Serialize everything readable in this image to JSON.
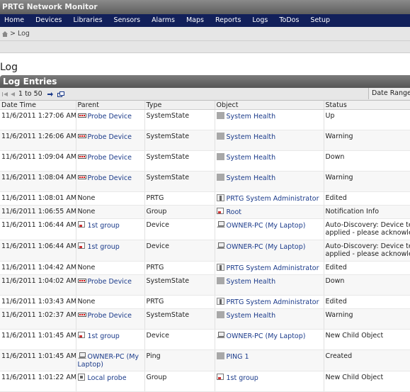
{
  "app": {
    "title": "PRTG Network Monitor"
  },
  "nav": [
    "Home",
    "Devices",
    "Libraries",
    "Sensors",
    "Alarms",
    "Maps",
    "Reports",
    "Logs",
    "ToDos",
    "Setup"
  ],
  "breadcrumb": {
    "separator": ">",
    "current": "Log"
  },
  "page_title": "Log",
  "panel": {
    "title": "Log Entries",
    "pager_range": "1 to 50",
    "date_range_label": "Date Range:"
  },
  "columns": [
    "Date Time",
    "Parent",
    "Type",
    "Object",
    "Status"
  ],
  "rows": [
    {
      "dt": "11/6/2011 1:27:06 AM",
      "parent": "Probe Device",
      "parent_icon": "device-icon",
      "type": "SystemState",
      "object": "System Health",
      "object_icon": "sensor-icon",
      "status": "Up",
      "status2": ""
    },
    {
      "dt": "11/6/2011 1:26:06 AM",
      "parent": "Probe Device",
      "parent_icon": "device-icon",
      "type": "SystemState",
      "object": "System Health",
      "object_icon": "sensor-icon",
      "status": "Warning",
      "status2": ""
    },
    {
      "dt": "11/6/2011 1:09:04 AM",
      "parent": "Probe Device",
      "parent_icon": "device-icon",
      "type": "SystemState",
      "object": "System Health",
      "object_icon": "sensor-icon",
      "status": "Down",
      "status2": ""
    },
    {
      "dt": "11/6/2011 1:08:04 AM",
      "parent": "Probe Device",
      "parent_icon": "device-icon",
      "type": "SystemState",
      "object": "System Health",
      "object_icon": "sensor-icon",
      "status": "Warning",
      "status2": ""
    },
    {
      "dt": "11/6/2011 1:08:01 AM",
      "parent": "None",
      "parent_icon": "",
      "type": "PRTG",
      "object": "PRTG System Administrator",
      "object_icon": "user-icon",
      "status": "Edited",
      "status2": ""
    },
    {
      "dt": "11/6/2011 1:06:55 AM",
      "parent": "None",
      "parent_icon": "",
      "type": "Group",
      "object": "Root",
      "object_icon": "group-icon",
      "status": "Notification Info",
      "status2": ""
    },
    {
      "dt": "11/6/2011 1:06:44 AM",
      "parent": "1st group",
      "parent_icon": "group-icon",
      "type": "Device",
      "object": "OWNER-PC (My Laptop)",
      "object_icon": "laptop-icon",
      "status": "Auto-Discovery: Device te",
      "status2": "applied - please acknowled"
    },
    {
      "dt": "11/6/2011 1:06:44 AM",
      "parent": "1st group",
      "parent_icon": "group-icon",
      "type": "Device",
      "object": "OWNER-PC (My Laptop)",
      "object_icon": "laptop-icon",
      "status": "Auto-Discovery: Device te",
      "status2": "applied - please acknowled"
    },
    {
      "dt": "11/6/2011 1:04:42 AM",
      "parent": "None",
      "parent_icon": "",
      "type": "PRTG",
      "object": "PRTG System Administrator",
      "object_icon": "user-icon",
      "status": "Edited",
      "status2": ""
    },
    {
      "dt": "11/6/2011 1:04:02 AM",
      "parent": "Probe Device",
      "parent_icon": "device-icon",
      "type": "SystemState",
      "object": "System Health",
      "object_icon": "sensor-icon",
      "status": "Down",
      "status2": ""
    },
    {
      "dt": "11/6/2011 1:03:43 AM",
      "parent": "None",
      "parent_icon": "",
      "type": "PRTG",
      "object": "PRTG System Administrator",
      "object_icon": "user-icon",
      "status": "Edited",
      "status2": ""
    },
    {
      "dt": "11/6/2011 1:02:37 AM",
      "parent": "Probe Device",
      "parent_icon": "device-icon",
      "type": "SystemState",
      "object": "System Health",
      "object_icon": "sensor-icon",
      "status": "Warning",
      "status2": ""
    },
    {
      "dt": "11/6/2011 1:01:45 AM",
      "parent": "1st group",
      "parent_icon": "group-icon",
      "type": "Device",
      "object": "OWNER-PC (My Laptop)",
      "object_icon": "laptop-icon",
      "status": "New Child Object",
      "status2": ""
    },
    {
      "dt": "11/6/2011 1:01:45 AM",
      "parent": "OWNER-PC (My Laptop)",
      "parent_icon": "laptop-icon",
      "type": "Ping",
      "object": "PING 1",
      "object_icon": "sensor-icon",
      "status": "Created",
      "status2": ""
    },
    {
      "dt": "11/6/2011 1:01:22 AM",
      "parent": "Local probe",
      "parent_icon": "probe-icon",
      "type": "Group",
      "object": "1st group",
      "object_icon": "group-icon",
      "status": "New Child Object",
      "status2": ""
    }
  ],
  "colors": {
    "nav_bg": "#12205a",
    "link": "#1a3a8a",
    "panel_head": "#666666"
  }
}
